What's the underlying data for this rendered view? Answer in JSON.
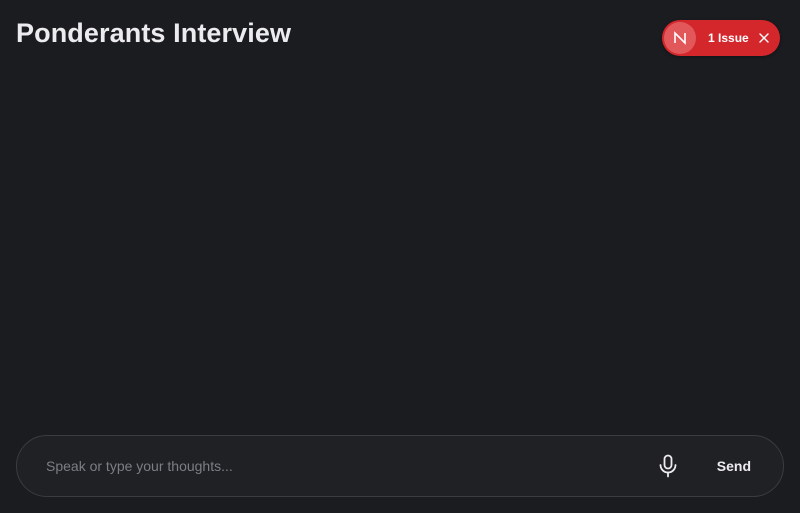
{
  "header": {
    "title": "Ponderants Interview"
  },
  "issue_indicator": {
    "avatar_letter": "N",
    "label": "1 Issue",
    "close_icon": "close-icon",
    "color": "#d4272c"
  },
  "composer": {
    "placeholder": "Speak or type your thoughts...",
    "value": "",
    "mic_icon": "microphone-icon",
    "send_label": "Send"
  },
  "theme": {
    "background": "#1b1c20",
    "accent_issue": "#d4272c"
  }
}
